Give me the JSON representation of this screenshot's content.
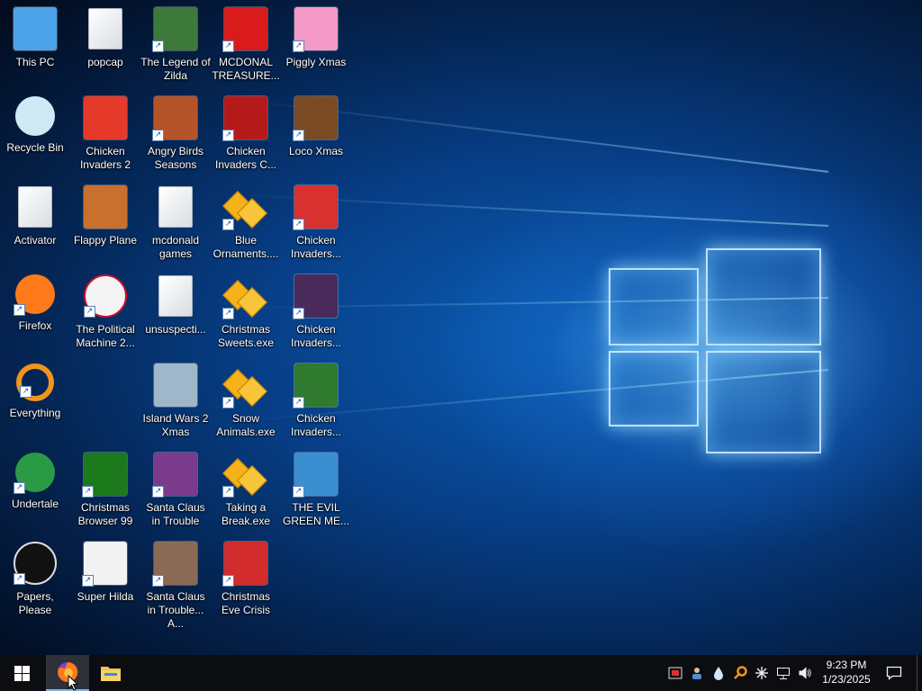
{
  "desktop": {
    "icons": [
      {
        "label": "This PC",
        "icon": "computer-icon",
        "color": "#4aa3e8"
      },
      {
        "label": "Recycle Bin",
        "icon": "recycle-bin-icon",
        "color": "#cfe9f5"
      },
      {
        "label": "Activator",
        "icon": "document-icon",
        "color": "#ffffff"
      },
      {
        "label": "Firefox",
        "icon": "firefox-icon",
        "color": "#ff7a1a"
      },
      {
        "label": "Everything",
        "icon": "everything-search-icon",
        "color": "#f0941e"
      },
      {
        "label": "Undertale",
        "icon": "undertale-icon",
        "color": "#2b9a45"
      },
      {
        "label": "Papers, Please",
        "icon": "papers-please-icon",
        "color": "#8b1a1a"
      },
      {
        "label": "popcap",
        "icon": "folder-icon",
        "color": "#ffffff"
      },
      {
        "label": "Chicken Invaders 2",
        "icon": "chicken-icon",
        "color": "#e53a2a"
      },
      {
        "label": "Flappy Plane",
        "icon": "plane-icon",
        "color": "#c9702e"
      },
      {
        "label": "The Political Machine 2...",
        "icon": "political-machine-icon",
        "color": "#c8102e"
      },
      {
        "label": "Christmas Browser 99",
        "icon": "christmas-tree-icon",
        "color": "#1c7a1c"
      },
      {
        "label": "Super Hilda",
        "icon": "super-hilda-icon",
        "color": "#f2f2f2"
      },
      {
        "label": "The Legend of Zilda",
        "icon": "zilda-icon",
        "color": "#3d7a3a"
      },
      {
        "label": "Angry Birds Seasons",
        "icon": "angry-birds-icon",
        "color": "#b5542a"
      },
      {
        "label": "mcdonald games",
        "icon": "folder-icon",
        "color": "#ffffff"
      },
      {
        "label": "unsuspecti...",
        "icon": "document-icon",
        "color": "#ffffff"
      },
      {
        "label": "Island Wars 2 Xmas",
        "icon": "island-wars-icon",
        "color": "#9fb7c9"
      },
      {
        "label": "Santa Claus in Trouble",
        "icon": "santa-icon",
        "color": "#7a3b8c"
      },
      {
        "label": "Santa Claus in Trouble... A...",
        "icon": "santa-icon",
        "color": "#8a6a54"
      },
      {
        "label": "MCDONAL TREASURE...",
        "icon": "mcdonalds-icon",
        "color": "#da1b1b"
      },
      {
        "label": "Chicken Invaders C...",
        "icon": "snowman-icon",
        "color": "#b51a1a"
      },
      {
        "label": "Blue Ornaments....",
        "icon": "gift-icon",
        "color": "#f5b21a"
      },
      {
        "label": "Christmas Sweets.exe",
        "icon": "gift-icon",
        "color": "#f5b21a"
      },
      {
        "label": "Snow Animals.exe",
        "icon": "gift-icon",
        "color": "#f5b21a"
      },
      {
        "label": "Taking a Break.exe",
        "icon": "gift-icon",
        "color": "#f5b21a"
      },
      {
        "label": "Christmas Eve Crisis",
        "icon": "santa-face-icon",
        "color": "#d22c2c"
      },
      {
        "label": "Piggly Xmas",
        "icon": "pig-icon",
        "color": "#f39ac6"
      },
      {
        "label": "Loco Xmas",
        "icon": "teddy-bear-icon",
        "color": "#7a4a24"
      },
      {
        "label": "Chicken Invaders...",
        "icon": "chicken-icon",
        "color": "#d93030"
      },
      {
        "label": "Chicken Invaders...",
        "icon": "chicken-icon",
        "color": "#4a2a5a"
      },
      {
        "label": "Chicken Invaders...",
        "icon": "chicken-icon",
        "color": "#2f7a2f"
      },
      {
        "label": "THE EVIL GREEN ME...",
        "icon": "messenger-icon",
        "color": "#3a8fd1"
      }
    ]
  },
  "taskbar": {
    "start_icon": "windows-logo-icon",
    "pinned": [
      {
        "name": "firefox-taskbar-icon",
        "active": true,
        "color": "#ff7a1a"
      },
      {
        "name": "file-explorer-taskbar-icon",
        "active": false,
        "color": "#f2c14e"
      }
    ],
    "tray_icons": [
      "security-icon",
      "user-agent-icon",
      "drop-icon",
      "search-tray-icon",
      "snowflake-icon",
      "network-icon",
      "volume-icon"
    ],
    "clock": {
      "time": "9:23 PM",
      "date": "1/23/2025"
    },
    "notification_icon": "action-center-icon"
  }
}
